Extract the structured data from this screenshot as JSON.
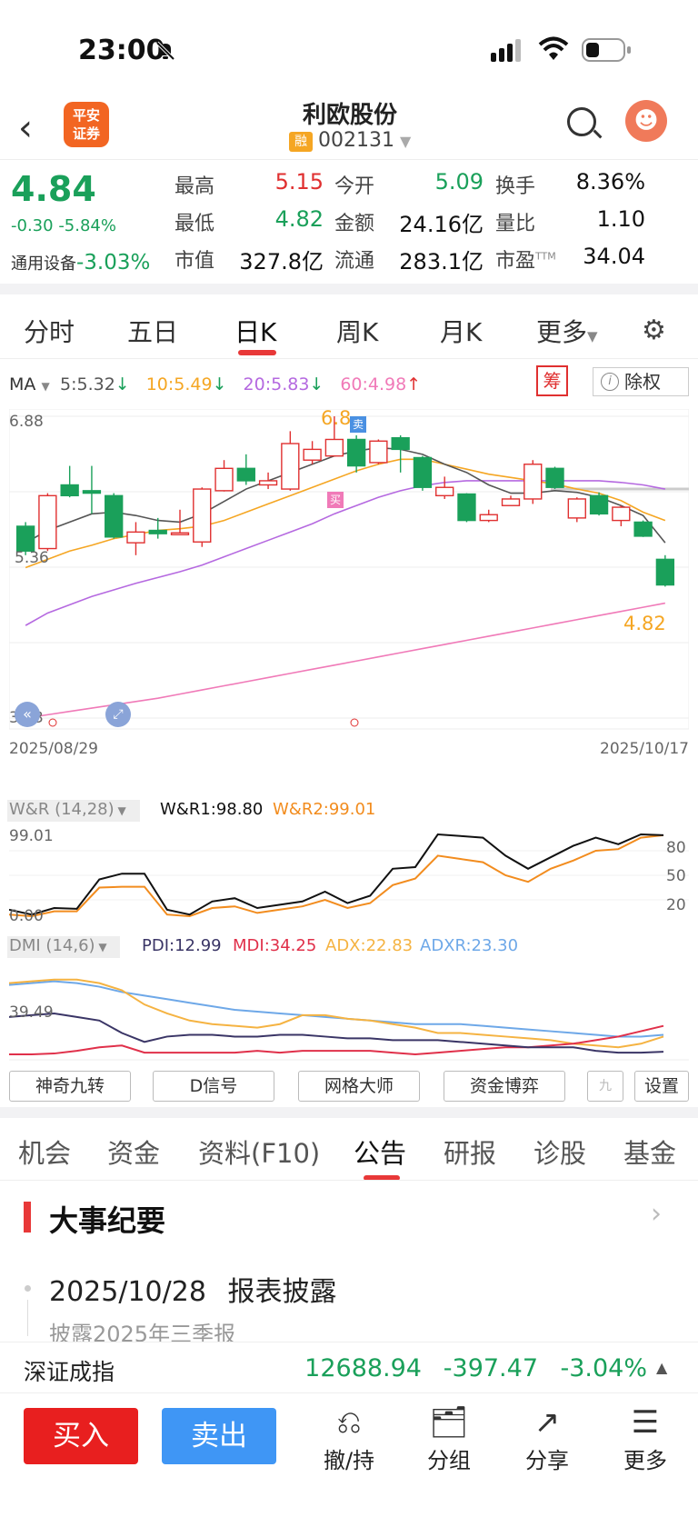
{
  "status": {
    "time": "23:00"
  },
  "header": {
    "logo": "平安\n证券",
    "title": "利欧股份",
    "badge": "融",
    "code": "002131",
    "avatar": "☻"
  },
  "quote": {
    "price": "4.84",
    "change": "-0.30",
    "change_pct": "-5.84%",
    "sector": "通用设备",
    "sector_pct": "-3.03%",
    "fields": [
      {
        "label": "最高",
        "value": "5.15",
        "color": "red"
      },
      {
        "label": "今开",
        "value": "5.09",
        "color": "green"
      },
      {
        "label": "换手",
        "value": "8.36%",
        "color": "black"
      },
      {
        "label": "最低",
        "value": "4.82",
        "color": "green"
      },
      {
        "label": "金额",
        "value": "24.16亿",
        "color": "black"
      },
      {
        "label": "量比",
        "value": "1.10",
        "color": "black"
      },
      {
        "label": "市值",
        "value": "327.8亿",
        "color": "black"
      },
      {
        "label": "流通",
        "value": "283.1亿",
        "color": "black"
      },
      {
        "label": "市盈",
        "value": "34.04",
        "color": "black",
        "sup": "TTM"
      }
    ]
  },
  "chart_tabs": {
    "items": [
      "分时",
      "五日",
      "日K",
      "周K",
      "月K",
      "更多"
    ],
    "active": "日K"
  },
  "ma_bar": {
    "label": "MA",
    "items": [
      {
        "text": "5:5.32",
        "arrow": "↓",
        "color": "#555555"
      },
      {
        "text": "10:5.49",
        "arrow": "↓",
        "color": "#f5a623"
      },
      {
        "text": "20:5.83",
        "arrow": "↓",
        "color": "#b569e0"
      },
      {
        "text": "60:4.98",
        "arrow": "↑",
        "color": "#f07ab8"
      }
    ],
    "chou": "筹",
    "chuquan": "除权"
  },
  "kline": {
    "top_label": "6.88",
    "bottom_label": "3.23",
    "left_mid": "5.36",
    "start_date": "2025/08/29",
    "end_date": "2025/10/17",
    "high_marker": "6.8",
    "low_marker": "4.82",
    "sell_tag": "卖",
    "buy_tag": "买",
    "price_min": 3.23,
    "price_max": 6.88,
    "candles": [
      {
        "o": 5.55,
        "c": 5.25,
        "h": 5.6,
        "l": 5.2
      },
      {
        "o": 5.28,
        "c": 5.92,
        "h": 5.95,
        "l": 5.25
      },
      {
        "o": 6.05,
        "c": 5.92,
        "h": 6.28,
        "l": 5.9
      },
      {
        "o": 5.98,
        "c": 5.95,
        "h": 6.28,
        "l": 5.7
      },
      {
        "o": 5.92,
        "c": 5.42,
        "h": 5.95,
        "l": 5.4
      },
      {
        "o": 5.35,
        "c": 5.48,
        "h": 5.6,
        "l": 5.2
      },
      {
        "o": 5.5,
        "c": 5.46,
        "h": 5.65,
        "l": 5.4
      },
      {
        "o": 5.47,
        "c": 5.47,
        "h": 5.75,
        "l": 5.45
      },
      {
        "o": 5.36,
        "c": 6.0,
        "h": 6.02,
        "l": 5.3
      },
      {
        "o": 5.98,
        "c": 6.25,
        "h": 6.35,
        "l": 5.97
      },
      {
        "o": 6.25,
        "c": 6.1,
        "h": 6.42,
        "l": 6.05
      },
      {
        "o": 6.05,
        "c": 6.1,
        "h": 6.2,
        "l": 6.0
      },
      {
        "o": 6.0,
        "c": 6.55,
        "h": 6.7,
        "l": 5.98
      },
      {
        "o": 6.35,
        "c": 6.48,
        "h": 6.58,
        "l": 6.3
      },
      {
        "o": 6.4,
        "c": 6.6,
        "h": 6.88,
        "l": 6.4
      },
      {
        "o": 6.6,
        "c": 6.28,
        "h": 6.65,
        "l": 6.2
      },
      {
        "o": 6.32,
        "c": 6.58,
        "h": 6.6,
        "l": 6.3
      },
      {
        "o": 6.62,
        "c": 6.48,
        "h": 6.65,
        "l": 6.2
      },
      {
        "o": 6.38,
        "c": 6.02,
        "h": 6.4,
        "l": 5.98
      },
      {
        "o": 5.92,
        "c": 6.02,
        "h": 6.15,
        "l": 5.88
      },
      {
        "o": 5.94,
        "c": 5.62,
        "h": 5.95,
        "l": 5.6
      },
      {
        "o": 5.62,
        "c": 5.69,
        "h": 5.75,
        "l": 5.6
      },
      {
        "o": 5.8,
        "c": 5.88,
        "h": 5.92,
        "l": 5.8
      },
      {
        "o": 5.88,
        "c": 6.3,
        "h": 6.35,
        "l": 5.82
      },
      {
        "o": 6.25,
        "c": 6.02,
        "h": 6.27,
        "l": 6.0
      },
      {
        "o": 5.65,
        "c": 5.88,
        "h": 5.9,
        "l": 5.6
      },
      {
        "o": 5.92,
        "c": 5.7,
        "h": 5.96,
        "l": 5.68
      },
      {
        "o": 5.62,
        "c": 5.78,
        "h": 5.8,
        "l": 5.55
      },
      {
        "o": 5.6,
        "c": 5.43,
        "h": 5.62,
        "l": 5.42
      },
      {
        "o": 5.15,
        "c": 4.84,
        "h": 5.2,
        "l": 4.82
      }
    ],
    "ma5": [
      5.35,
      5.5,
      5.6,
      5.7,
      5.72,
      5.68,
      5.62,
      5.6,
      5.7,
      5.85,
      6.0,
      6.1,
      6.2,
      6.3,
      6.4,
      6.46,
      6.5,
      6.48,
      6.42,
      6.3,
      6.2,
      6.05,
      5.95,
      5.95,
      5.98,
      5.96,
      5.9,
      5.8,
      5.68,
      5.35
    ],
    "ma10": [
      5.05,
      5.15,
      5.25,
      5.32,
      5.4,
      5.45,
      5.5,
      5.52,
      5.55,
      5.62,
      5.72,
      5.82,
      5.92,
      6.02,
      6.12,
      6.22,
      6.3,
      6.36,
      6.36,
      6.3,
      6.24,
      6.18,
      6.14,
      6.1,
      6.06,
      6.0,
      5.95,
      5.86,
      5.72,
      5.62
    ],
    "ma20": [
      4.35,
      4.5,
      4.6,
      4.7,
      4.78,
      4.86,
      4.93,
      5.0,
      5.08,
      5.18,
      5.28,
      5.38,
      5.48,
      5.58,
      5.7,
      5.8,
      5.9,
      5.98,
      6.04,
      6.08,
      6.1,
      6.1,
      6.1,
      6.1,
      6.1,
      6.1,
      6.1,
      6.08,
      6.05,
      6.0
    ],
    "ma60": [
      3.23,
      3.27,
      3.31,
      3.35,
      3.39,
      3.43,
      3.47,
      3.52,
      3.57,
      3.62,
      3.67,
      3.72,
      3.77,
      3.82,
      3.87,
      3.92,
      3.97,
      4.02,
      4.07,
      4.12,
      4.17,
      4.22,
      4.27,
      4.32,
      4.37,
      4.42,
      4.47,
      4.52,
      4.57,
      4.62
    ]
  },
  "wr": {
    "label": "W&R (14,28)",
    "wr1_label": "W&R1:98.80",
    "wr2_label": "W&R2:99.01",
    "top": "99.01",
    "bottom": "0.00",
    "levels": [
      "80",
      "50",
      "20"
    ],
    "wr1": [
      8,
      2,
      10,
      9,
      45,
      52,
      52,
      8,
      2,
      18,
      22,
      10,
      14,
      18,
      30,
      16,
      25,
      58,
      60,
      100,
      98,
      96,
      74,
      58,
      72,
      86,
      96,
      88,
      100,
      99
    ],
    "wr2": [
      2,
      0,
      6,
      6,
      35,
      36,
      36,
      2,
      0,
      10,
      12,
      4,
      8,
      12,
      20,
      10,
      16,
      38,
      46,
      74,
      70,
      66,
      50,
      42,
      58,
      68,
      80,
      82,
      96,
      99
    ]
  },
  "dmi": {
    "label": "DMI (14,6)",
    "pdi_label": "PDI:12.99",
    "mdi_label": "MDI:34.25",
    "adx_label": "ADX:22.83",
    "adxr_label": "ADXR:23.30",
    "ref": "39.49",
    "pdi": [
      44,
      46,
      48,
      44,
      40,
      26,
      16,
      22,
      24,
      24,
      22,
      22,
      24,
      24,
      22,
      20,
      20,
      18,
      18,
      18,
      16,
      14,
      12,
      10,
      10,
      10,
      6,
      4,
      4,
      5
    ],
    "mdi": [
      2,
      2,
      3,
      6,
      10,
      12,
      4,
      4,
      4,
      4,
      4,
      6,
      4,
      6,
      6,
      6,
      6,
      4,
      2,
      4,
      6,
      8,
      10,
      10,
      12,
      14,
      18,
      22,
      28,
      34
    ],
    "adx": [
      82,
      84,
      86,
      86,
      82,
      74,
      58,
      48,
      40,
      36,
      34,
      32,
      36,
      46,
      46,
      42,
      40,
      36,
      32,
      26,
      26,
      24,
      22,
      20,
      18,
      14,
      12,
      10,
      14,
      22
    ],
    "adxr": [
      80,
      82,
      84,
      82,
      78,
      72,
      68,
      64,
      60,
      56,
      52,
      50,
      48,
      46,
      44,
      42,
      40,
      38,
      36,
      36,
      36,
      34,
      32,
      30,
      28,
      26,
      24,
      22,
      22,
      24
    ]
  },
  "indicator_tabs": [
    "神奇九转",
    "D信号",
    "网格大师",
    "资金博弈",
    "九",
    "设置"
  ],
  "func_tabs": {
    "items": [
      "机会",
      "资金",
      "资料(F10)",
      "公告",
      "研报",
      "诊股",
      "基金"
    ],
    "active": "公告"
  },
  "section": {
    "title": "大事纪要",
    "event_date": "2025/10/28",
    "event_title": "报表披露",
    "event_sub": "披露2025年三季报"
  },
  "ticker": {
    "name": "深证成指",
    "value": "12688.94",
    "change": "-397.47",
    "pct": "-3.04%"
  },
  "bottom_bar": {
    "buy": "买入",
    "sell": "卖出",
    "items": [
      {
        "icon": "⎌",
        "label": "撤/持"
      },
      {
        "icon": "🗂",
        "label": "分组"
      },
      {
        "icon": "↗",
        "label": "分享"
      },
      {
        "icon": "☰",
        "label": "更多"
      }
    ]
  },
  "colors": {
    "up": "#e03030",
    "down": "#1aa05a",
    "ma5": "#555555",
    "ma10": "#f5a623",
    "ma20": "#b569e0",
    "ma60": "#f07ab8",
    "wr1": "#111111",
    "wr2": "#f28c1e",
    "pdi": "#3a3566",
    "mdi": "#e0304a",
    "adx": "#f5b342",
    "adxr": "#6ea8e8"
  }
}
